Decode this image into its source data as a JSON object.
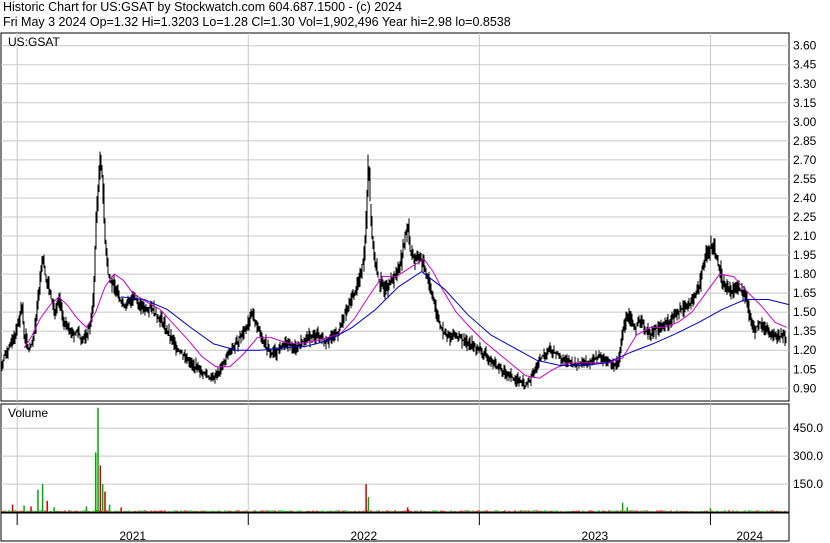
{
  "header": {
    "line1": "Historic Chart for US:GSAT by Stockwatch.com 604.687.1500 - (c) 2024",
    "line2": "Fri May  3 2024   Op=1.32   Hi=1.3203   Lo=1.28   Cl=1.30   Vol=1,902,496   Year hi=2.98   lo=0.8538"
  },
  "chart_data": [
    {
      "type": "line",
      "title": "US:GSAT",
      "series_note": "daily high-low price bars with two moving averages",
      "colors": {
        "price": "#000000",
        "ma_short": "#cc00cc",
        "ma_long": "#0000cc",
        "grid": "#c8c8c8"
      },
      "ylim": [
        0.8,
        3.7
      ],
      "yticks": [
        "3.60",
        "3.45",
        "3.30",
        "3.15",
        "3.00",
        "2.85",
        "2.70",
        "2.55",
        "2.40",
        "2.25",
        "2.10",
        "1.95",
        "1.80",
        "1.65",
        "1.50",
        "1.35",
        "1.20",
        "1.05",
        "0.90"
      ],
      "x_range": [
        2020.93,
        2024.34
      ],
      "x_year_boundaries": [
        2021.0,
        2022.0,
        2023.0,
        2024.0
      ],
      "price": [
        [
          2020.93,
          1.08
        ],
        [
          2020.95,
          1.18
        ],
        [
          2020.98,
          1.28
        ],
        [
          2021.0,
          1.38
        ],
        [
          2021.02,
          1.55
        ],
        [
          2021.03,
          1.32
        ],
        [
          2021.05,
          1.2
        ],
        [
          2021.07,
          1.28
        ],
        [
          2021.09,
          1.62
        ],
        [
          2021.11,
          1.95
        ],
        [
          2021.12,
          1.8
        ],
        [
          2021.14,
          1.66
        ],
        [
          2021.16,
          1.5
        ],
        [
          2021.18,
          1.6
        ],
        [
          2021.2,
          1.42
        ],
        [
          2021.22,
          1.38
        ],
        [
          2021.24,
          1.32
        ],
        [
          2021.26,
          1.35
        ],
        [
          2021.28,
          1.28
        ],
        [
          2021.3,
          1.32
        ],
        [
          2021.32,
          1.45
        ],
        [
          2021.33,
          1.62
        ],
        [
          2021.34,
          2.2
        ],
        [
          2021.35,
          2.5
        ],
        [
          2021.36,
          2.72
        ],
        [
          2021.37,
          2.5
        ],
        [
          2021.38,
          2.05
        ],
        [
          2021.39,
          1.85
        ],
        [
          2021.41,
          1.72
        ],
        [
          2021.43,
          1.68
        ],
        [
          2021.45,
          1.58
        ],
        [
          2021.47,
          1.55
        ],
        [
          2021.5,
          1.62
        ],
        [
          2021.52,
          1.58
        ],
        [
          2021.55,
          1.52
        ],
        [
          2021.58,
          1.55
        ],
        [
          2021.6,
          1.48
        ],
        [
          2021.63,
          1.42
        ],
        [
          2021.66,
          1.3
        ],
        [
          2021.69,
          1.22
        ],
        [
          2021.72,
          1.16
        ],
        [
          2021.75,
          1.1
        ],
        [
          2021.78,
          1.05
        ],
        [
          2021.81,
          1.02
        ],
        [
          2021.84,
          0.97
        ],
        [
          2021.86,
          1.0
        ],
        [
          2021.88,
          1.05
        ],
        [
          2021.9,
          1.12
        ],
        [
          2021.92,
          1.2
        ],
        [
          2021.95,
          1.25
        ],
        [
          2021.97,
          1.32
        ],
        [
          2022.0,
          1.42
        ],
        [
          2022.02,
          1.48
        ],
        [
          2022.04,
          1.38
        ],
        [
          2022.06,
          1.3
        ],
        [
          2022.08,
          1.22
        ],
        [
          2022.1,
          1.18
        ],
        [
          2022.13,
          1.2
        ],
        [
          2022.16,
          1.25
        ],
        [
          2022.2,
          1.22
        ],
        [
          2022.23,
          1.26
        ],
        [
          2022.26,
          1.3
        ],
        [
          2022.3,
          1.32
        ],
        [
          2022.33,
          1.28
        ],
        [
          2022.36,
          1.3
        ],
        [
          2022.39,
          1.35
        ],
        [
          2022.42,
          1.5
        ],
        [
          2022.45,
          1.62
        ],
        [
          2022.48,
          1.75
        ],
        [
          2022.5,
          1.95
        ],
        [
          2022.51,
          2.25
        ],
        [
          2022.52,
          2.75
        ],
        [
          2022.53,
          2.2
        ],
        [
          2022.55,
          1.85
        ],
        [
          2022.57,
          1.72
        ],
        [
          2022.59,
          1.68
        ],
        [
          2022.62,
          1.75
        ],
        [
          2022.64,
          1.8
        ],
        [
          2022.66,
          1.92
        ],
        [
          2022.68,
          2.1
        ],
        [
          2022.69,
          2.2
        ],
        [
          2022.7,
          2.0
        ],
        [
          2022.72,
          1.9
        ],
        [
          2022.74,
          1.95
        ],
        [
          2022.76,
          1.85
        ],
        [
          2022.78,
          1.75
        ],
        [
          2022.8,
          1.6
        ],
        [
          2022.82,
          1.45
        ],
        [
          2022.84,
          1.35
        ],
        [
          2022.86,
          1.3
        ],
        [
          2022.9,
          1.32
        ],
        [
          2022.93,
          1.28
        ],
        [
          2022.96,
          1.25
        ],
        [
          2023.0,
          1.2
        ],
        [
          2023.03,
          1.15
        ],
        [
          2023.06,
          1.1
        ],
        [
          2023.09,
          1.05
        ],
        [
          2023.12,
          1.0
        ],
        [
          2023.15,
          0.98
        ],
        [
          2023.18,
          0.95
        ],
        [
          2023.2,
          0.92
        ],
        [
          2023.22,
          0.96
        ],
        [
          2023.24,
          1.05
        ],
        [
          2023.27,
          1.15
        ],
        [
          2023.3,
          1.2
        ],
        [
          2023.33,
          1.18
        ],
        [
          2023.36,
          1.12
        ],
        [
          2023.39,
          1.1
        ],
        [
          2023.42,
          1.08
        ],
        [
          2023.45,
          1.12
        ],
        [
          2023.48,
          1.1
        ],
        [
          2023.51,
          1.15
        ],
        [
          2023.54,
          1.12
        ],
        [
          2023.57,
          1.1
        ],
        [
          2023.6,
          1.08
        ],
        [
          2023.62,
          1.35
        ],
        [
          2023.64,
          1.5
        ],
        [
          2023.66,
          1.42
        ],
        [
          2023.68,
          1.38
        ],
        [
          2023.7,
          1.45
        ],
        [
          2023.72,
          1.35
        ],
        [
          2023.74,
          1.32
        ],
        [
          2023.77,
          1.38
        ],
        [
          2023.8,
          1.4
        ],
        [
          2023.83,
          1.45
        ],
        [
          2023.86,
          1.5
        ],
        [
          2023.89,
          1.55
        ],
        [
          2023.92,
          1.58
        ],
        [
          2023.95,
          1.7
        ],
        [
          2023.97,
          1.9
        ],
        [
          2023.99,
          1.98
        ],
        [
          2024.01,
          2.05
        ],
        [
          2024.03,
          1.9
        ],
        [
          2024.05,
          1.75
        ],
        [
          2024.07,
          1.7
        ],
        [
          2024.09,
          1.65
        ],
        [
          2024.11,
          1.72
        ],
        [
          2024.13,
          1.68
        ],
        [
          2024.15,
          1.65
        ],
        [
          2024.17,
          1.45
        ],
        [
          2024.19,
          1.35
        ],
        [
          2024.21,
          1.42
        ],
        [
          2024.23,
          1.38
        ],
        [
          2024.25,
          1.35
        ],
        [
          2024.27,
          1.32
        ],
        [
          2024.29,
          1.3
        ],
        [
          2024.31,
          1.32
        ],
        [
          2024.33,
          1.3
        ]
      ],
      "ma_short": [
        [
          2021.03,
          1.22
        ],
        [
          2021.06,
          1.3
        ],
        [
          2021.1,
          1.45
        ],
        [
          2021.14,
          1.55
        ],
        [
          2021.18,
          1.62
        ],
        [
          2021.22,
          1.55
        ],
        [
          2021.26,
          1.45
        ],
        [
          2021.3,
          1.38
        ],
        [
          2021.34,
          1.5
        ],
        [
          2021.38,
          1.7
        ],
        [
          2021.42,
          1.8
        ],
        [
          2021.46,
          1.75
        ],
        [
          2021.5,
          1.65
        ],
        [
          2021.56,
          1.58
        ],
        [
          2021.62,
          1.52
        ],
        [
          2021.68,
          1.4
        ],
        [
          2021.74,
          1.28
        ],
        [
          2021.8,
          1.15
        ],
        [
          2021.86,
          1.07
        ],
        [
          2021.92,
          1.07
        ],
        [
          2021.98,
          1.17
        ],
        [
          2022.04,
          1.3
        ],
        [
          2022.1,
          1.3
        ],
        [
          2022.16,
          1.26
        ],
        [
          2022.22,
          1.25
        ],
        [
          2022.28,
          1.27
        ],
        [
          2022.34,
          1.3
        ],
        [
          2022.4,
          1.33
        ],
        [
          2022.46,
          1.45
        ],
        [
          2022.52,
          1.62
        ],
        [
          2022.58,
          1.78
        ],
        [
          2022.64,
          1.78
        ],
        [
          2022.7,
          1.85
        ],
        [
          2022.76,
          1.92
        ],
        [
          2022.8,
          1.82
        ],
        [
          2022.84,
          1.68
        ],
        [
          2022.9,
          1.5
        ],
        [
          2022.96,
          1.38
        ],
        [
          2023.02,
          1.27
        ],
        [
          2023.08,
          1.18
        ],
        [
          2023.14,
          1.09
        ],
        [
          2023.2,
          1.0
        ],
        [
          2023.26,
          0.98
        ],
        [
          2023.32,
          1.05
        ],
        [
          2023.38,
          1.1
        ],
        [
          2023.44,
          1.1
        ],
        [
          2023.5,
          1.1
        ],
        [
          2023.56,
          1.1
        ],
        [
          2023.62,
          1.14
        ],
        [
          2023.68,
          1.32
        ],
        [
          2023.74,
          1.38
        ],
        [
          2023.8,
          1.38
        ],
        [
          2023.86,
          1.42
        ],
        [
          2023.92,
          1.5
        ],
        [
          2023.98,
          1.65
        ],
        [
          2024.04,
          1.8
        ],
        [
          2024.1,
          1.78
        ],
        [
          2024.16,
          1.66
        ],
        [
          2024.22,
          1.55
        ],
        [
          2024.28,
          1.42
        ],
        [
          2024.33,
          1.38
        ]
      ],
      "ma_long": [
        [
          2021.45,
          1.62
        ],
        [
          2021.55,
          1.6
        ],
        [
          2021.65,
          1.52
        ],
        [
          2021.75,
          1.38
        ],
        [
          2021.85,
          1.25
        ],
        [
          2021.95,
          1.2
        ],
        [
          2022.05,
          1.2
        ],
        [
          2022.15,
          1.22
        ],
        [
          2022.25,
          1.23
        ],
        [
          2022.35,
          1.28
        ],
        [
          2022.45,
          1.38
        ],
        [
          2022.55,
          1.52
        ],
        [
          2022.65,
          1.7
        ],
        [
          2022.75,
          1.82
        ],
        [
          2022.85,
          1.68
        ],
        [
          2022.95,
          1.48
        ],
        [
          2023.05,
          1.32
        ],
        [
          2023.15,
          1.22
        ],
        [
          2023.25,
          1.12
        ],
        [
          2023.35,
          1.08
        ],
        [
          2023.45,
          1.08
        ],
        [
          2023.55,
          1.1
        ],
        [
          2023.65,
          1.18
        ],
        [
          2023.75,
          1.25
        ],
        [
          2023.85,
          1.33
        ],
        [
          2023.95,
          1.42
        ],
        [
          2024.05,
          1.52
        ],
        [
          2024.15,
          1.6
        ],
        [
          2024.25,
          1.6
        ],
        [
          2024.34,
          1.56
        ]
      ]
    },
    {
      "type": "bar",
      "title": "Volume",
      "ylim": [
        0,
        580
      ],
      "yticks": [
        "450.0",
        "300.0",
        "150.0"
      ],
      "colors": {
        "up": "#00aa00",
        "down": "#cc0000"
      },
      "volume": [
        [
          2020.98,
          40,
          "down"
        ],
        [
          2021.03,
          35,
          "up"
        ],
        [
          2021.06,
          30,
          "down"
        ],
        [
          2021.09,
          120,
          "up"
        ],
        [
          2021.11,
          150,
          "up"
        ],
        [
          2021.13,
          60,
          "down"
        ],
        [
          2021.16,
          25,
          "up"
        ],
        [
          2021.3,
          30,
          "up"
        ],
        [
          2021.34,
          320,
          "up"
        ],
        [
          2021.35,
          560,
          "up"
        ],
        [
          2021.36,
          250,
          "down"
        ],
        [
          2021.37,
          150,
          "up"
        ],
        [
          2021.38,
          110,
          "down"
        ],
        [
          2021.4,
          40,
          "up"
        ],
        [
          2021.45,
          25,
          "down"
        ],
        [
          2022.51,
          150,
          "down"
        ],
        [
          2022.52,
          80,
          "up"
        ],
        [
          2022.69,
          25,
          "down"
        ],
        [
          2023.62,
          50,
          "up"
        ],
        [
          2023.64,
          25,
          "up"
        ],
        [
          2024.0,
          20,
          "up"
        ]
      ],
      "x_labels": [
        "2021",
        "2022",
        "2023",
        "2024"
      ]
    }
  ]
}
